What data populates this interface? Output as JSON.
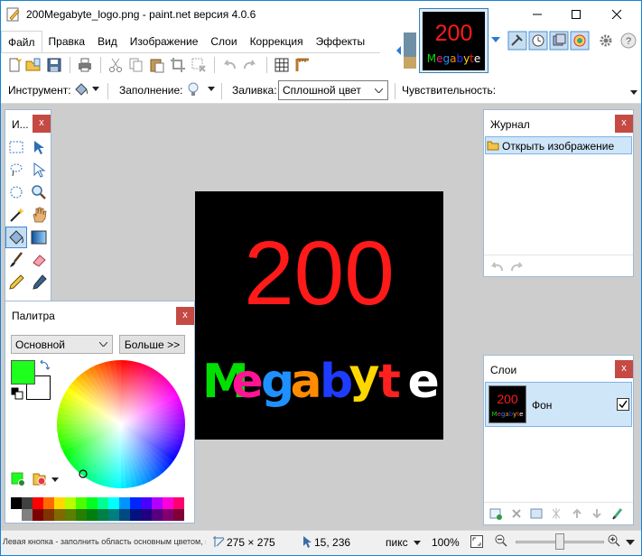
{
  "window": {
    "title": "200Megabyte_logo.png - paint.net версия 4.0.6"
  },
  "menu": [
    "Файл",
    "Правка",
    "Вид",
    "Изображение",
    "Слои",
    "Коррекция",
    "Эффекты"
  ],
  "toolbar2": {
    "tool_label": "Инструмент:",
    "fill_label": "Заполнение:",
    "flood_label": "Заливка:",
    "flood_value": "Сплошной цвет",
    "tolerance_label": "Чувствительность:"
  },
  "tools_panel": {
    "title": "И...",
    "close": "x"
  },
  "history_panel": {
    "title": "Журнал",
    "close": "x",
    "items": [
      "Открыть изображение"
    ]
  },
  "layers_panel": {
    "title": "Слои",
    "close": "x",
    "layer_name": "Фон"
  },
  "palette_panel": {
    "title": "Палитра",
    "close": "x",
    "mode": "Основной",
    "more_button": "Больше >>",
    "primary_color": "#1dff1d",
    "secondary_color": "#ffffff",
    "swatches_top": [
      "#000000",
      "#404040",
      "#ff0000",
      "#ff6a00",
      "#ffd800",
      "#b6ff00",
      "#4cff00",
      "#00ff21",
      "#00ff90",
      "#00ffff",
      "#0094ff",
      "#0026ff",
      "#4800ff",
      "#b200ff",
      "#ff00dc",
      "#ff006e"
    ],
    "swatches_bottom": [
      "#ffffff",
      "#808080",
      "#7f0000",
      "#7f3300",
      "#7f6a00",
      "#5b7f00",
      "#267f00",
      "#007f0e",
      "#007f46",
      "#007f7f",
      "#004a7f",
      "#00137f",
      "#21007f",
      "#57007f",
      "#7f006e",
      "#7f0037"
    ]
  },
  "image": {
    "number": "200",
    "word_letters": [
      "M",
      "e",
      "g",
      "a",
      "b",
      "y",
      "t",
      "e"
    ],
    "letter_colors": [
      "#00e000",
      "#ff1493",
      "#1e90ff",
      "#ff8c00",
      "#1e3cff",
      "#ffd700",
      "#ff2020",
      "#ffffff"
    ],
    "number_color": "#ff1a1a"
  },
  "status": {
    "hint": "Левая кнопка - заполнить область основным цветом, правая кно...",
    "size": "275 × 275",
    "position": "15, 236",
    "units": "пикс",
    "zoom": "100%",
    "zoom_fraction": 0.5
  }
}
